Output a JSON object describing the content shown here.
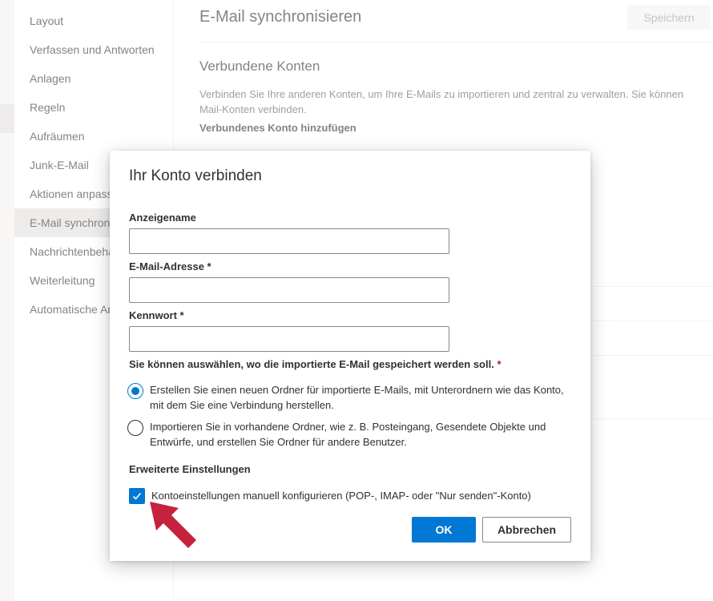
{
  "sidebar": {
    "items": [
      {
        "label": "Layout",
        "active": false
      },
      {
        "label": "Verfassen und Antworten",
        "active": false
      },
      {
        "label": "Anlagen",
        "active": false
      },
      {
        "label": "Regeln",
        "active": false
      },
      {
        "label": "Aufräumen",
        "active": false
      },
      {
        "label": "Junk-E-Mail",
        "active": false
      },
      {
        "label": "Aktionen anpassen",
        "active": false
      },
      {
        "label": "E-Mail synchronisieren",
        "active": true
      },
      {
        "label": "Nachrichtenbehandlung",
        "active": false
      },
      {
        "label": "Weiterleitung",
        "active": false
      },
      {
        "label": "Automatische Antworten",
        "active": false
      }
    ]
  },
  "main": {
    "title": "E-Mail synchronisieren",
    "save_label": "Speichern",
    "section_title": "Verbundene Konten",
    "description_line1": "Verbinden Sie Ihre anderen Konten, um Ihre E-Mails zu importieren und zentral zu verwalten. Sie können",
    "description_line2": "Mail-Konten verbinden.",
    "add_account_label": "Verbundenes Konto hinzufügen"
  },
  "dialog": {
    "title": "Ihr Konto verbinden",
    "display_name_label": "Anzeigename",
    "display_name_value": "",
    "email_label": "E-Mail-Adresse *",
    "email_value": "",
    "password_label": "Kennwort *",
    "password_value": "",
    "storage_question": "Sie können auswählen, wo die importierte E-Mail gespeichert werden soll.",
    "required_mark": "*",
    "option_new_folder": "Erstellen Sie einen neuen Ordner für importierte E-Mails, mit Unterordnern wie das Konto, mit dem Sie eine Verbindung herstellen.",
    "option_existing_folders": "Importieren Sie in vorhandene Ordner, wie z. B. Posteingang, Gesendete Objekte und Entwürfe, und erstellen Sie Ordner für andere Benutzer.",
    "selected_option": "new-folder",
    "advanced_label": "Erweiterte Einstellungen",
    "manual_config_label": "Kontoeinstellungen manuell konfigurieren (POP-, IMAP- oder \"Nur senden\"-Konto)",
    "manual_config_checked": true,
    "ok_label": "OK",
    "cancel_label": "Abbrechen"
  },
  "colors": {
    "accent": "#0078d4",
    "arrow": "#c4223d"
  }
}
